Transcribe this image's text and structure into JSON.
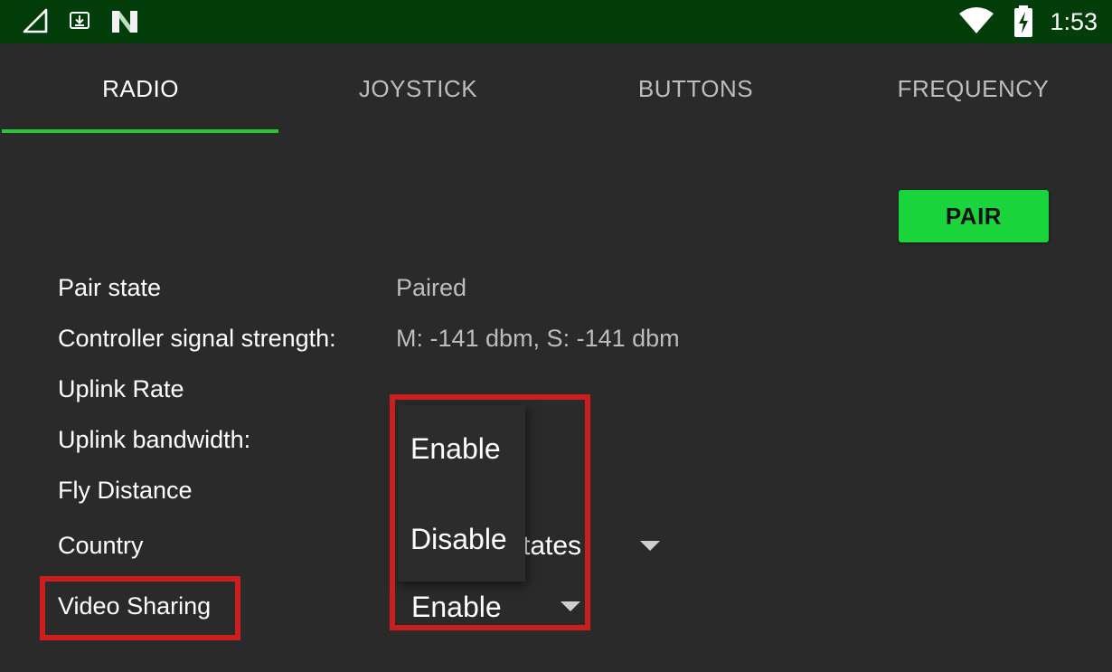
{
  "status_bar": {
    "time": "1:53",
    "icons": [
      "signal-icon",
      "download-icon",
      "app-n-icon",
      "wifi-icon",
      "battery-charging-icon"
    ]
  },
  "tabs": [
    {
      "label": "RADIO",
      "active": true
    },
    {
      "label": "JOYSTICK",
      "active": false
    },
    {
      "label": "BUTTONS",
      "active": false
    },
    {
      "label": "FREQUENCY",
      "active": false
    }
  ],
  "pair_button": {
    "label": "PAIR"
  },
  "fields": {
    "pair_state": {
      "label": "Pair state",
      "value": "Paired"
    },
    "signal_strength": {
      "label": "Controller signal strength:",
      "value": "M: -141 dbm, S: -141 dbm"
    },
    "uplink_rate": {
      "label": "Uplink Rate"
    },
    "uplink_bandwidth": {
      "label": "Uplink bandwidth:"
    },
    "fly_distance": {
      "label": "Fly Distance"
    },
    "country": {
      "label": "Country",
      "value_visible": "tates"
    },
    "video_sharing": {
      "label": "Video Sharing",
      "value": "Enable"
    }
  },
  "dropdown": {
    "options": [
      "Enable",
      "Disable"
    ]
  },
  "colors": {
    "accent": "#22c932",
    "pair_button": "#19d43a",
    "status_bar": "#033d0a",
    "background": "#2a2a2a",
    "highlight": "#cc1e1e"
  }
}
